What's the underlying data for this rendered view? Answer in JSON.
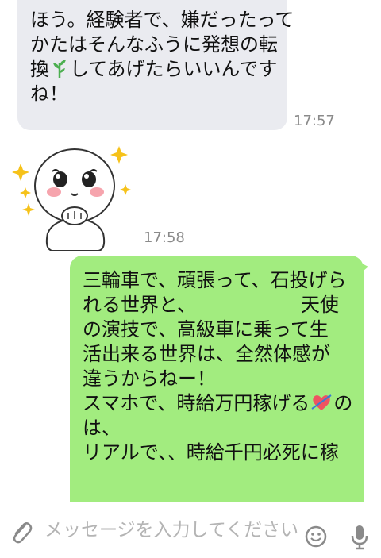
{
  "messages": {
    "incoming_text": {
      "lines": [
        "ほう。経験者で、嫌だったって",
        "かたはそんなふうに発想の転",
        "換",
        "してあげたらいいんです",
        "ね！"
      ],
      "emoji": "seedling",
      "time": "17:57"
    },
    "incoming_sticker": {
      "sticker_name": "white round character sticker with sparkles",
      "time": "17:58"
    },
    "outgoing_text": {
      "lines": [
        "三輪車で、頑張って、石投げら",
        "れる世界と、　　　　　　天使",
        "の演技で、高級車に乗って生",
        "活出来る世界は、全然体感が",
        "違うからねー！",
        "スマホで、時給万円稼げる",
        "の",
        "は、",
        "リアルで、、時給千円必死に稼"
      ],
      "emoji": "heart-with-arrow"
    }
  },
  "input_bar": {
    "placeholder": "メッセージを入力してください。",
    "attach_icon": "paperclip-icon",
    "emoji_icon": "smiley-icon",
    "mic_icon": "microphone-icon"
  },
  "colors": {
    "incoming_bubble": "#eaebf0",
    "outgoing_bubble": "#a2ec7f",
    "timestamp": "#8a8a8a",
    "background": "#ffffff"
  }
}
